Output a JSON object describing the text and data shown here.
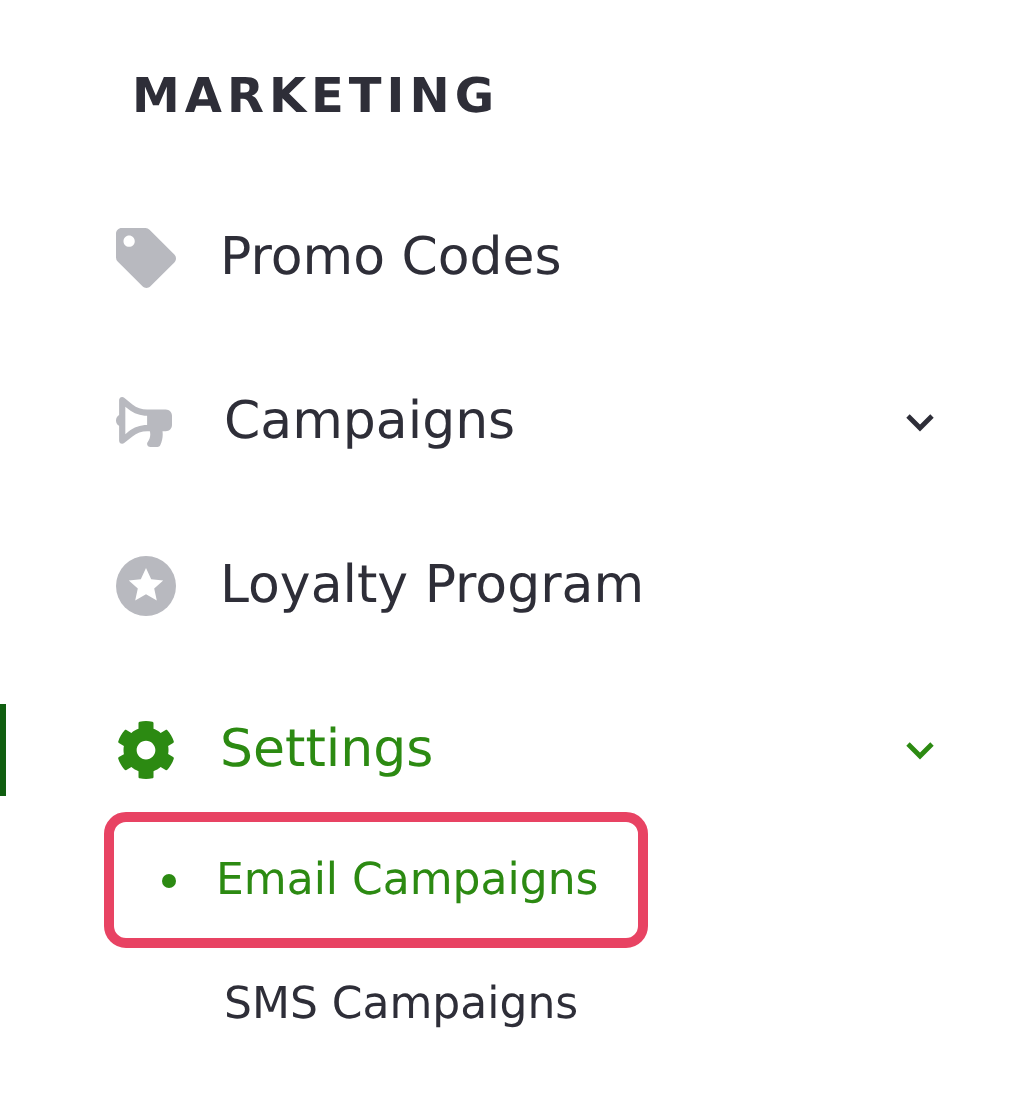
{
  "section_title": "MARKETING",
  "items": [
    {
      "label": "Promo Codes",
      "kind": "tag",
      "selected": false,
      "expandable": false
    },
    {
      "label": "Campaigns",
      "kind": "megaphone",
      "selected": false,
      "expandable": true
    },
    {
      "label": "Loyalty Program",
      "kind": "star",
      "selected": false,
      "expandable": false
    },
    {
      "label": "Settings",
      "kind": "gear",
      "selected": true,
      "expandable": true,
      "children": [
        {
          "label": "Email Campaigns",
          "selected": true,
          "highlighted": true
        },
        {
          "label": "SMS Campaigns",
          "selected": false,
          "highlighted": false
        }
      ]
    }
  ]
}
